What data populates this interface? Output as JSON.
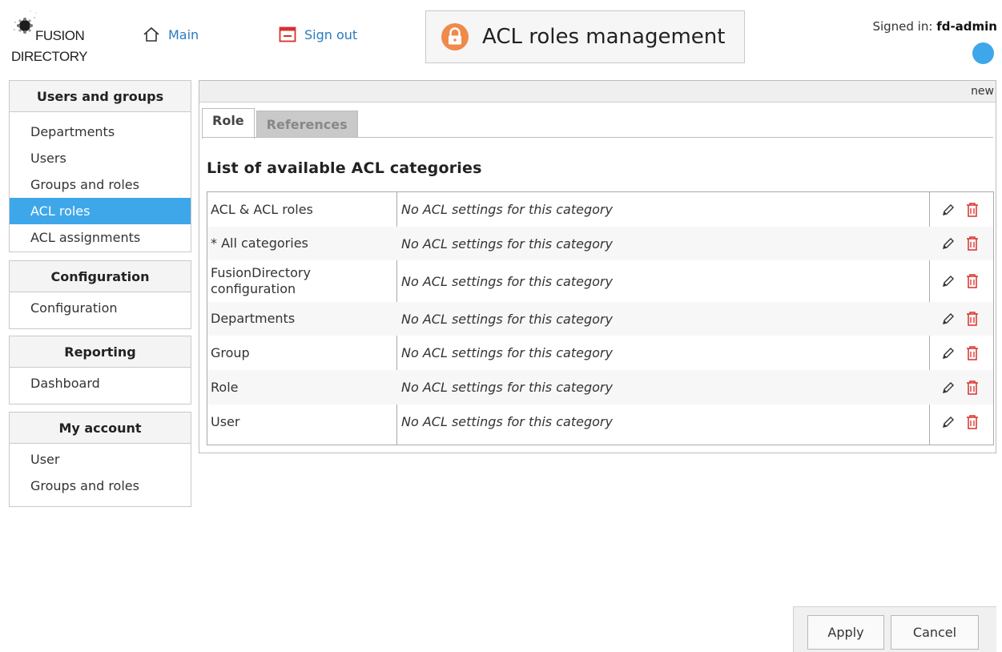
{
  "header": {
    "logo": {
      "line1": "FUSION",
      "line2": "DIRECTORY"
    },
    "nav": {
      "main_label": "Main",
      "signout_label": "Sign out"
    },
    "page_title": "ACL roles management",
    "signed_in_label": "Signed in:",
    "signed_in_user": "fd-admin",
    "status_dot_color": "#3ea7ea"
  },
  "sidebar": {
    "sections": [
      {
        "title": "Users and groups",
        "items": [
          "Departments",
          "Users",
          "Groups and roles",
          "ACL roles",
          "ACL assignments"
        ],
        "active_item": "ACL roles"
      },
      {
        "title": "Configuration",
        "items": [
          "Configuration"
        ]
      },
      {
        "title": "Reporting",
        "items": [
          "Dashboard"
        ]
      },
      {
        "title": "My account",
        "items": [
          "User",
          "Groups and roles"
        ]
      }
    ]
  },
  "main": {
    "topbar_label": "new",
    "tabs": [
      {
        "label": "Role",
        "active": true
      },
      {
        "label": "References",
        "active": false
      }
    ],
    "list_heading": "List of available ACL categories",
    "rows": [
      {
        "category": "ACL & ACL roles",
        "description": "No ACL settings for this category"
      },
      {
        "category": "* All categories",
        "description": "No ACL settings for this category"
      },
      {
        "category": "FusionDirectory configuration",
        "description": "No ACL settings for this category"
      },
      {
        "category": "Departments",
        "description": "No ACL settings for this category"
      },
      {
        "category": "Group",
        "description": "No ACL settings for this category"
      },
      {
        "category": "Role",
        "description": "No ACL settings for this category"
      },
      {
        "category": "User",
        "description": "No ACL settings for this category"
      }
    ],
    "row_actions": [
      "edit-icon",
      "delete-icon"
    ]
  },
  "footer": {
    "apply_label": "Apply",
    "cancel_label": "Cancel"
  },
  "colors": {
    "accent": "#3ea7ea",
    "link": "#2b7bc0",
    "delete": "#d9302c",
    "lock_badge": "#f08a4b"
  }
}
